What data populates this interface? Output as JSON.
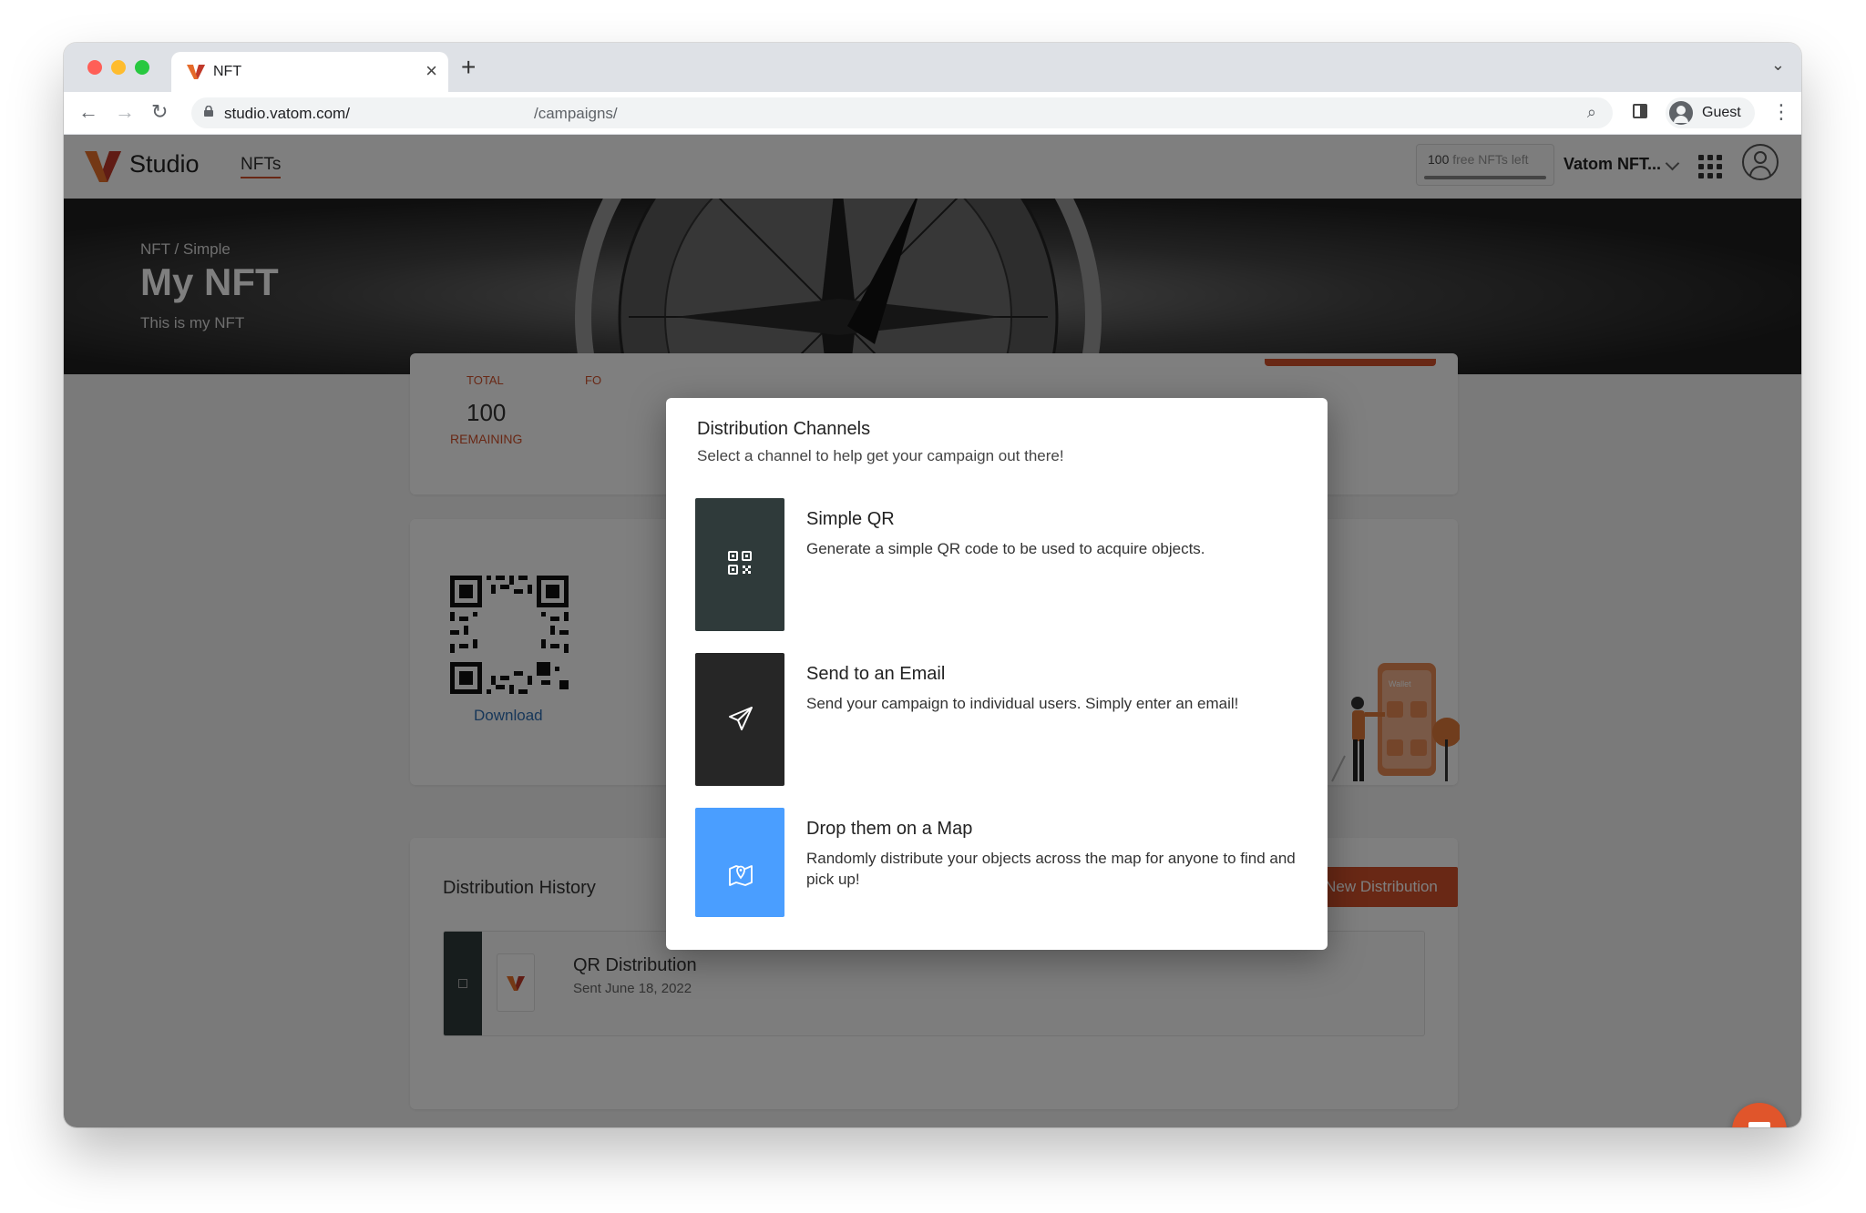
{
  "browser": {
    "tab_title": "NFT",
    "url_host": "studio.vatom.com/",
    "url_path": "/campaigns/",
    "profile_name": "Guest"
  },
  "header": {
    "brand": "Studio",
    "nav_item": "NFTs",
    "free_nfts_count": "100",
    "free_nfts_suffix": "free NFTs left",
    "org_name": "Vatom NFT..."
  },
  "hero": {
    "breadcrumb": "NFT / Simple",
    "title": "My NFT",
    "description": "This is my NFT"
  },
  "stats": {
    "total_label": "TOTAL",
    "partial_label": "FO",
    "remaining_value": "100",
    "remaining_label": "REMAINING"
  },
  "qr_card": {
    "download_label": "Download",
    "illustration_text": "Wallet"
  },
  "history": {
    "title": "Distribution History",
    "new_button": "New Distribution",
    "rows": [
      {
        "name": "QR Distribution",
        "date": "Sent June 18, 2022"
      }
    ]
  },
  "modal": {
    "title": "Distribution Channels",
    "subtitle": "Select a channel to help get your campaign out there!",
    "channels": [
      {
        "name": "Simple QR",
        "description": "Generate a simple QR code to be used to acquire objects.",
        "icon": "qr-code-icon",
        "color": "#2f3a3a"
      },
      {
        "name": "Send to an Email",
        "description": "Send your campaign to individual users. Simply enter an email!",
        "icon": "paper-plane-icon",
        "color": "#262626"
      },
      {
        "name": "Drop them on a Map",
        "description": "Randomly distribute your objects across the map for anyone to find and pick up!",
        "icon": "map-pin-icon",
        "color": "#4a9eff"
      }
    ]
  },
  "colors": {
    "accent": "#d2502b",
    "link": "#2f6fb3",
    "map_tile": "#4a9eff"
  }
}
